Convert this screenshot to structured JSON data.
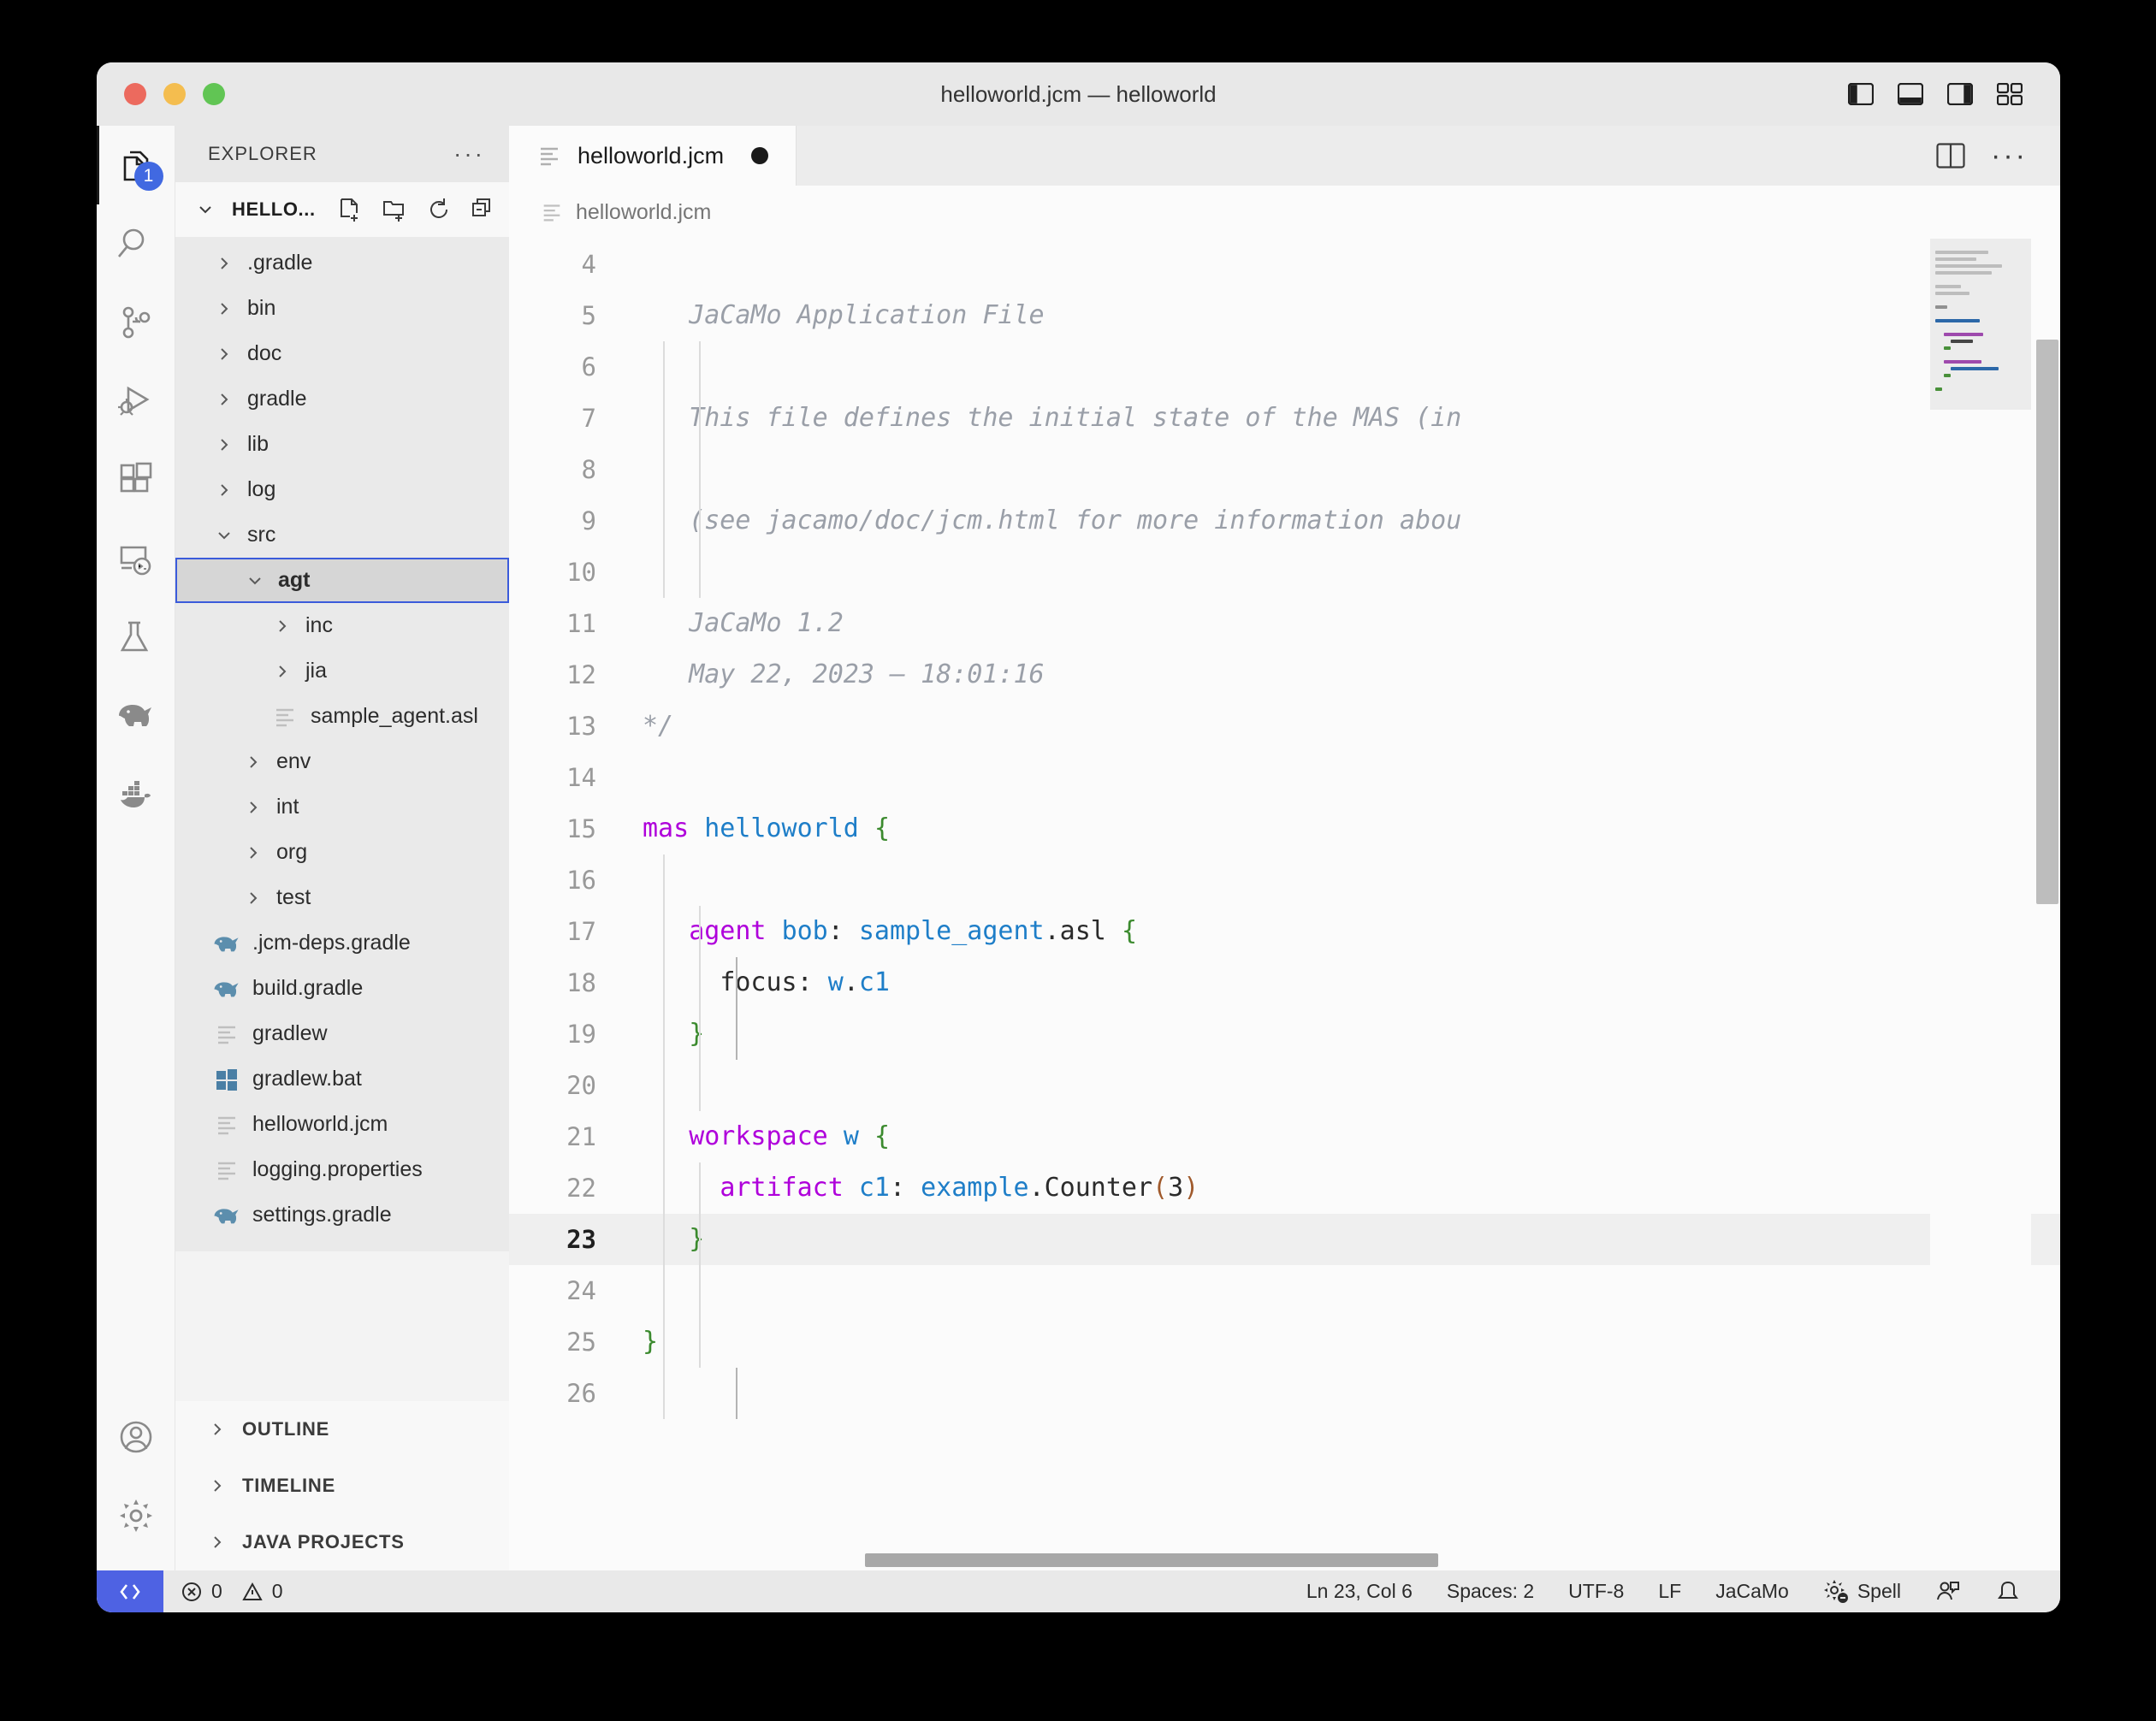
{
  "window": {
    "title": "helloworld.jcm — helloworld",
    "traffic_lights": [
      "close",
      "minimize",
      "maximize"
    ],
    "layout_icons": [
      "toggle-primary-sidebar",
      "toggle-panel",
      "toggle-secondary-sidebar",
      "customize-layout"
    ]
  },
  "activitybar": {
    "items": [
      {
        "name": "explorer",
        "icon": "files-icon",
        "badge": "1",
        "active": true
      },
      {
        "name": "search",
        "icon": "search-icon",
        "badge": "",
        "active": false
      },
      {
        "name": "source-control",
        "icon": "source-control-icon",
        "badge": "",
        "active": false
      },
      {
        "name": "run-and-debug",
        "icon": "run-debug-icon",
        "badge": "",
        "active": false
      },
      {
        "name": "extensions",
        "icon": "extensions-icon",
        "badge": "",
        "active": false
      },
      {
        "name": "remote-explorer",
        "icon": "remote-explorer-icon",
        "badge": "",
        "active": false
      },
      {
        "name": "testing",
        "icon": "beaker-icon",
        "badge": "",
        "active": false
      },
      {
        "name": "gradle",
        "icon": "elephant-icon",
        "badge": "",
        "active": false
      },
      {
        "name": "docker",
        "icon": "docker-icon",
        "badge": "",
        "active": false
      }
    ],
    "bottom_items": [
      {
        "name": "accounts",
        "icon": "account-icon"
      },
      {
        "name": "manage",
        "icon": "gear-icon"
      }
    ]
  },
  "sidebar": {
    "header": "EXPLORER",
    "header_more": "···",
    "root_label": "HELLO...",
    "root_actions": [
      "new-file-icon",
      "new-folder-icon",
      "refresh-icon",
      "collapse-all-icon"
    ],
    "tree": [
      {
        "label": ".gradle",
        "indent": 0,
        "type": "folder",
        "expanded": false,
        "selected": false,
        "icon": "chevron-right-icon"
      },
      {
        "label": "bin",
        "indent": 0,
        "type": "folder",
        "expanded": false,
        "selected": false,
        "icon": "chevron-right-icon"
      },
      {
        "label": "doc",
        "indent": 0,
        "type": "folder",
        "expanded": false,
        "selected": false,
        "icon": "chevron-right-icon"
      },
      {
        "label": "gradle",
        "indent": 0,
        "type": "folder",
        "expanded": false,
        "selected": false,
        "icon": "chevron-right-icon"
      },
      {
        "label": "lib",
        "indent": 0,
        "type": "folder",
        "expanded": false,
        "selected": false,
        "icon": "chevron-right-icon"
      },
      {
        "label": "log",
        "indent": 0,
        "type": "folder",
        "expanded": false,
        "selected": false,
        "icon": "chevron-right-icon"
      },
      {
        "label": "src",
        "indent": 0,
        "type": "folder",
        "expanded": true,
        "selected": false,
        "icon": "chevron-down-icon"
      },
      {
        "label": "agt",
        "indent": 1,
        "type": "folder",
        "expanded": true,
        "selected": true,
        "icon": "chevron-down-icon"
      },
      {
        "label": "inc",
        "indent": 2,
        "type": "folder",
        "expanded": false,
        "selected": false,
        "icon": "chevron-right-icon"
      },
      {
        "label": "jia",
        "indent": 2,
        "type": "folder",
        "expanded": false,
        "selected": false,
        "icon": "chevron-right-icon"
      },
      {
        "label": "sample_agent.asl",
        "indent": 2,
        "type": "file",
        "expanded": false,
        "selected": false,
        "icon": "text-file-icon"
      },
      {
        "label": "env",
        "indent": 1,
        "type": "folder",
        "expanded": false,
        "selected": false,
        "icon": "chevron-right-icon"
      },
      {
        "label": "int",
        "indent": 1,
        "type": "folder",
        "expanded": false,
        "selected": false,
        "icon": "chevron-right-icon"
      },
      {
        "label": "org",
        "indent": 1,
        "type": "folder",
        "expanded": false,
        "selected": false,
        "icon": "chevron-right-icon"
      },
      {
        "label": "test",
        "indent": 1,
        "type": "folder",
        "expanded": false,
        "selected": false,
        "icon": "chevron-right-icon"
      },
      {
        "label": ".jcm-deps.gradle",
        "indent": 0,
        "type": "file",
        "expanded": false,
        "selected": false,
        "icon": "gradle-icon"
      },
      {
        "label": "build.gradle",
        "indent": 0,
        "type": "file",
        "expanded": false,
        "selected": false,
        "icon": "gradle-icon"
      },
      {
        "label": "gradlew",
        "indent": 0,
        "type": "file",
        "expanded": false,
        "selected": false,
        "icon": "text-file-icon"
      },
      {
        "label": "gradlew.bat",
        "indent": 0,
        "type": "file",
        "expanded": false,
        "selected": false,
        "icon": "windows-icon"
      },
      {
        "label": "helloworld.jcm",
        "indent": 0,
        "type": "file",
        "expanded": false,
        "selected": false,
        "icon": "text-file-icon"
      },
      {
        "label": "logging.properties",
        "indent": 0,
        "type": "file",
        "expanded": false,
        "selected": false,
        "icon": "text-file-icon"
      },
      {
        "label": "settings.gradle",
        "indent": 0,
        "type": "file",
        "expanded": false,
        "selected": false,
        "icon": "gradle-icon"
      }
    ],
    "panels": [
      {
        "label": "OUTLINE",
        "icon": "chevron-right-icon"
      },
      {
        "label": "TIMELINE",
        "icon": "chevron-right-icon"
      },
      {
        "label": "JAVA PROJECTS",
        "icon": "chevron-right-icon"
      }
    ]
  },
  "editor": {
    "tabs": [
      {
        "label": "helloworld.jcm",
        "icon": "text-file-icon",
        "dirty": true,
        "active": true
      }
    ],
    "tab_actions": [
      "split-editor-icon",
      "more-actions-icon"
    ],
    "breadcrumb": {
      "icon": "text-file-icon",
      "label": "helloworld.jcm"
    },
    "first_visible_line": 4,
    "lines": [
      {
        "n": 4,
        "current": false,
        "tokens": [
          {
            "t": "",
            "c": "tx"
          }
        ]
      },
      {
        "n": 5,
        "current": false,
        "tokens": [
          {
            "t": "   ",
            "c": "tx"
          },
          {
            "t": "JaCaMo Application File",
            "c": "cm"
          }
        ]
      },
      {
        "n": 6,
        "current": false,
        "tokens": [
          {
            "t": "",
            "c": "tx"
          }
        ]
      },
      {
        "n": 7,
        "current": false,
        "tokens": [
          {
            "t": "   ",
            "c": "tx"
          },
          {
            "t": "This file defines the initial state of the MAS (in",
            "c": "cm"
          }
        ]
      },
      {
        "n": 8,
        "current": false,
        "tokens": [
          {
            "t": "",
            "c": "tx"
          }
        ]
      },
      {
        "n": 9,
        "current": false,
        "tokens": [
          {
            "t": "   ",
            "c": "tx"
          },
          {
            "t": "(see jacamo/doc/jcm.html for more information abou",
            "c": "cm"
          }
        ]
      },
      {
        "n": 10,
        "current": false,
        "tokens": [
          {
            "t": "",
            "c": "tx"
          }
        ]
      },
      {
        "n": 11,
        "current": false,
        "tokens": [
          {
            "t": "   ",
            "c": "tx"
          },
          {
            "t": "JaCaMo 1.2",
            "c": "cm"
          }
        ]
      },
      {
        "n": 12,
        "current": false,
        "tokens": [
          {
            "t": "   ",
            "c": "tx"
          },
          {
            "t": "May 22, 2023 – 18:01:16",
            "c": "cm"
          }
        ]
      },
      {
        "n": 13,
        "current": false,
        "tokens": [
          {
            "t": "*/",
            "c": "cm"
          }
        ]
      },
      {
        "n": 14,
        "current": false,
        "tokens": [
          {
            "t": "",
            "c": "tx"
          }
        ]
      },
      {
        "n": 15,
        "current": false,
        "tokens": [
          {
            "t": "mas",
            "c": "kw"
          },
          {
            "t": " ",
            "c": "tx"
          },
          {
            "t": "helloworld",
            "c": "id"
          },
          {
            "t": " ",
            "c": "tx"
          },
          {
            "t": "{",
            "c": "br"
          }
        ]
      },
      {
        "n": 16,
        "current": false,
        "tokens": [
          {
            "t": "",
            "c": "tx"
          }
        ]
      },
      {
        "n": 17,
        "current": false,
        "tokens": [
          {
            "t": "   ",
            "c": "tx"
          },
          {
            "t": "agent",
            "c": "kw"
          },
          {
            "t": " ",
            "c": "tx"
          },
          {
            "t": "bob",
            "c": "id"
          },
          {
            "t": ": ",
            "c": "tx"
          },
          {
            "t": "sample_agent",
            "c": "id"
          },
          {
            "t": ".asl ",
            "c": "tx"
          },
          {
            "t": "{",
            "c": "br"
          }
        ]
      },
      {
        "n": 18,
        "current": false,
        "tokens": [
          {
            "t": "     ",
            "c": "tx"
          },
          {
            "t": "focus: ",
            "c": "tx"
          },
          {
            "t": "w",
            "c": "id"
          },
          {
            "t": ".",
            "c": "tx"
          },
          {
            "t": "c1",
            "c": "id"
          }
        ]
      },
      {
        "n": 19,
        "current": false,
        "tokens": [
          {
            "t": "   ",
            "c": "tx"
          },
          {
            "t": "}",
            "c": "br"
          }
        ]
      },
      {
        "n": 20,
        "current": false,
        "tokens": [
          {
            "t": "",
            "c": "tx"
          }
        ]
      },
      {
        "n": 21,
        "current": false,
        "tokens": [
          {
            "t": "   ",
            "c": "tx"
          },
          {
            "t": "workspace",
            "c": "kw"
          },
          {
            "t": " ",
            "c": "tx"
          },
          {
            "t": "w",
            "c": "id"
          },
          {
            "t": " ",
            "c": "tx"
          },
          {
            "t": "{",
            "c": "br"
          }
        ]
      },
      {
        "n": 22,
        "current": false,
        "tokens": [
          {
            "t": "     ",
            "c": "tx"
          },
          {
            "t": "artifact",
            "c": "kw"
          },
          {
            "t": " ",
            "c": "tx"
          },
          {
            "t": "c1",
            "c": "id"
          },
          {
            "t": ": ",
            "c": "tx"
          },
          {
            "t": "example",
            "c": "id"
          },
          {
            "t": ".Counter",
            "c": "tx"
          },
          {
            "t": "(",
            "c": "pl"
          },
          {
            "t": "3",
            "c": "tx"
          },
          {
            "t": ")",
            "c": "pl"
          }
        ]
      },
      {
        "n": 23,
        "current": true,
        "tokens": [
          {
            "t": "   ",
            "c": "tx"
          },
          {
            "t": "}",
            "c": "br"
          }
        ]
      },
      {
        "n": 24,
        "current": false,
        "tokens": [
          {
            "t": "",
            "c": "tx"
          }
        ]
      },
      {
        "n": 25,
        "current": false,
        "tokens": [
          {
            "t": "}",
            "c": "br"
          }
        ]
      },
      {
        "n": 26,
        "current": false,
        "tokens": [
          {
            "t": "",
            "c": "tx"
          }
        ]
      }
    ]
  },
  "statusbar": {
    "remote_icon": "remote-window-icon",
    "errors_icon": "error-icon",
    "errors": "0",
    "warnings_icon": "warning-icon",
    "warnings": "0",
    "cursor": "Ln 23, Col 6",
    "indentation": "Spaces: 2",
    "encoding": "UTF-8",
    "eol": "LF",
    "language": "JaCaMo",
    "spell_icon": "gear-spell-icon",
    "spell": "Spell",
    "feedback_icon": "feedback-icon",
    "bell_icon": "bell-icon"
  },
  "colors": {
    "keyword": "#af00db",
    "identifier": "#1e7ec8",
    "brace": "#3b8a2e",
    "comment": "#9a9fa8",
    "paren": "#a05a2c",
    "selection_border": "#3b5bdb",
    "badge": "#4169e1",
    "remote": "#4e62e3"
  }
}
